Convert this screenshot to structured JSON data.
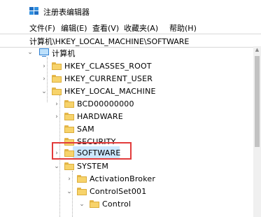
{
  "window": {
    "title": "注册表编辑器"
  },
  "menu": [
    "文件(F)",
    "编辑(E)",
    "查看(V)",
    "收藏夹(A)",
    "帮助(H)"
  ],
  "address": "计算机\\HKEY_LOCAL_MACHINE\\SOFTWARE",
  "tree": {
    "root": "计算机",
    "hkcr": "HKEY_CLASSES_ROOT",
    "hkcu": "HKEY_CURRENT_USER",
    "hklm": "HKEY_LOCAL_MACHINE",
    "bcd": "BCD00000000",
    "hardware": "HARDWARE",
    "sam": "SAM",
    "security": "SECURITY",
    "software": "SOFTWARE",
    "system": "SYSTEM",
    "activation": "ActivationBroker",
    "controlset": "ControlSet001",
    "control": "Control"
  },
  "selected_key": "SOFTWARE",
  "colors": {
    "selection": "#cce8ff",
    "highlight_border": "#e23b3b",
    "folder": "#f7d36b"
  }
}
